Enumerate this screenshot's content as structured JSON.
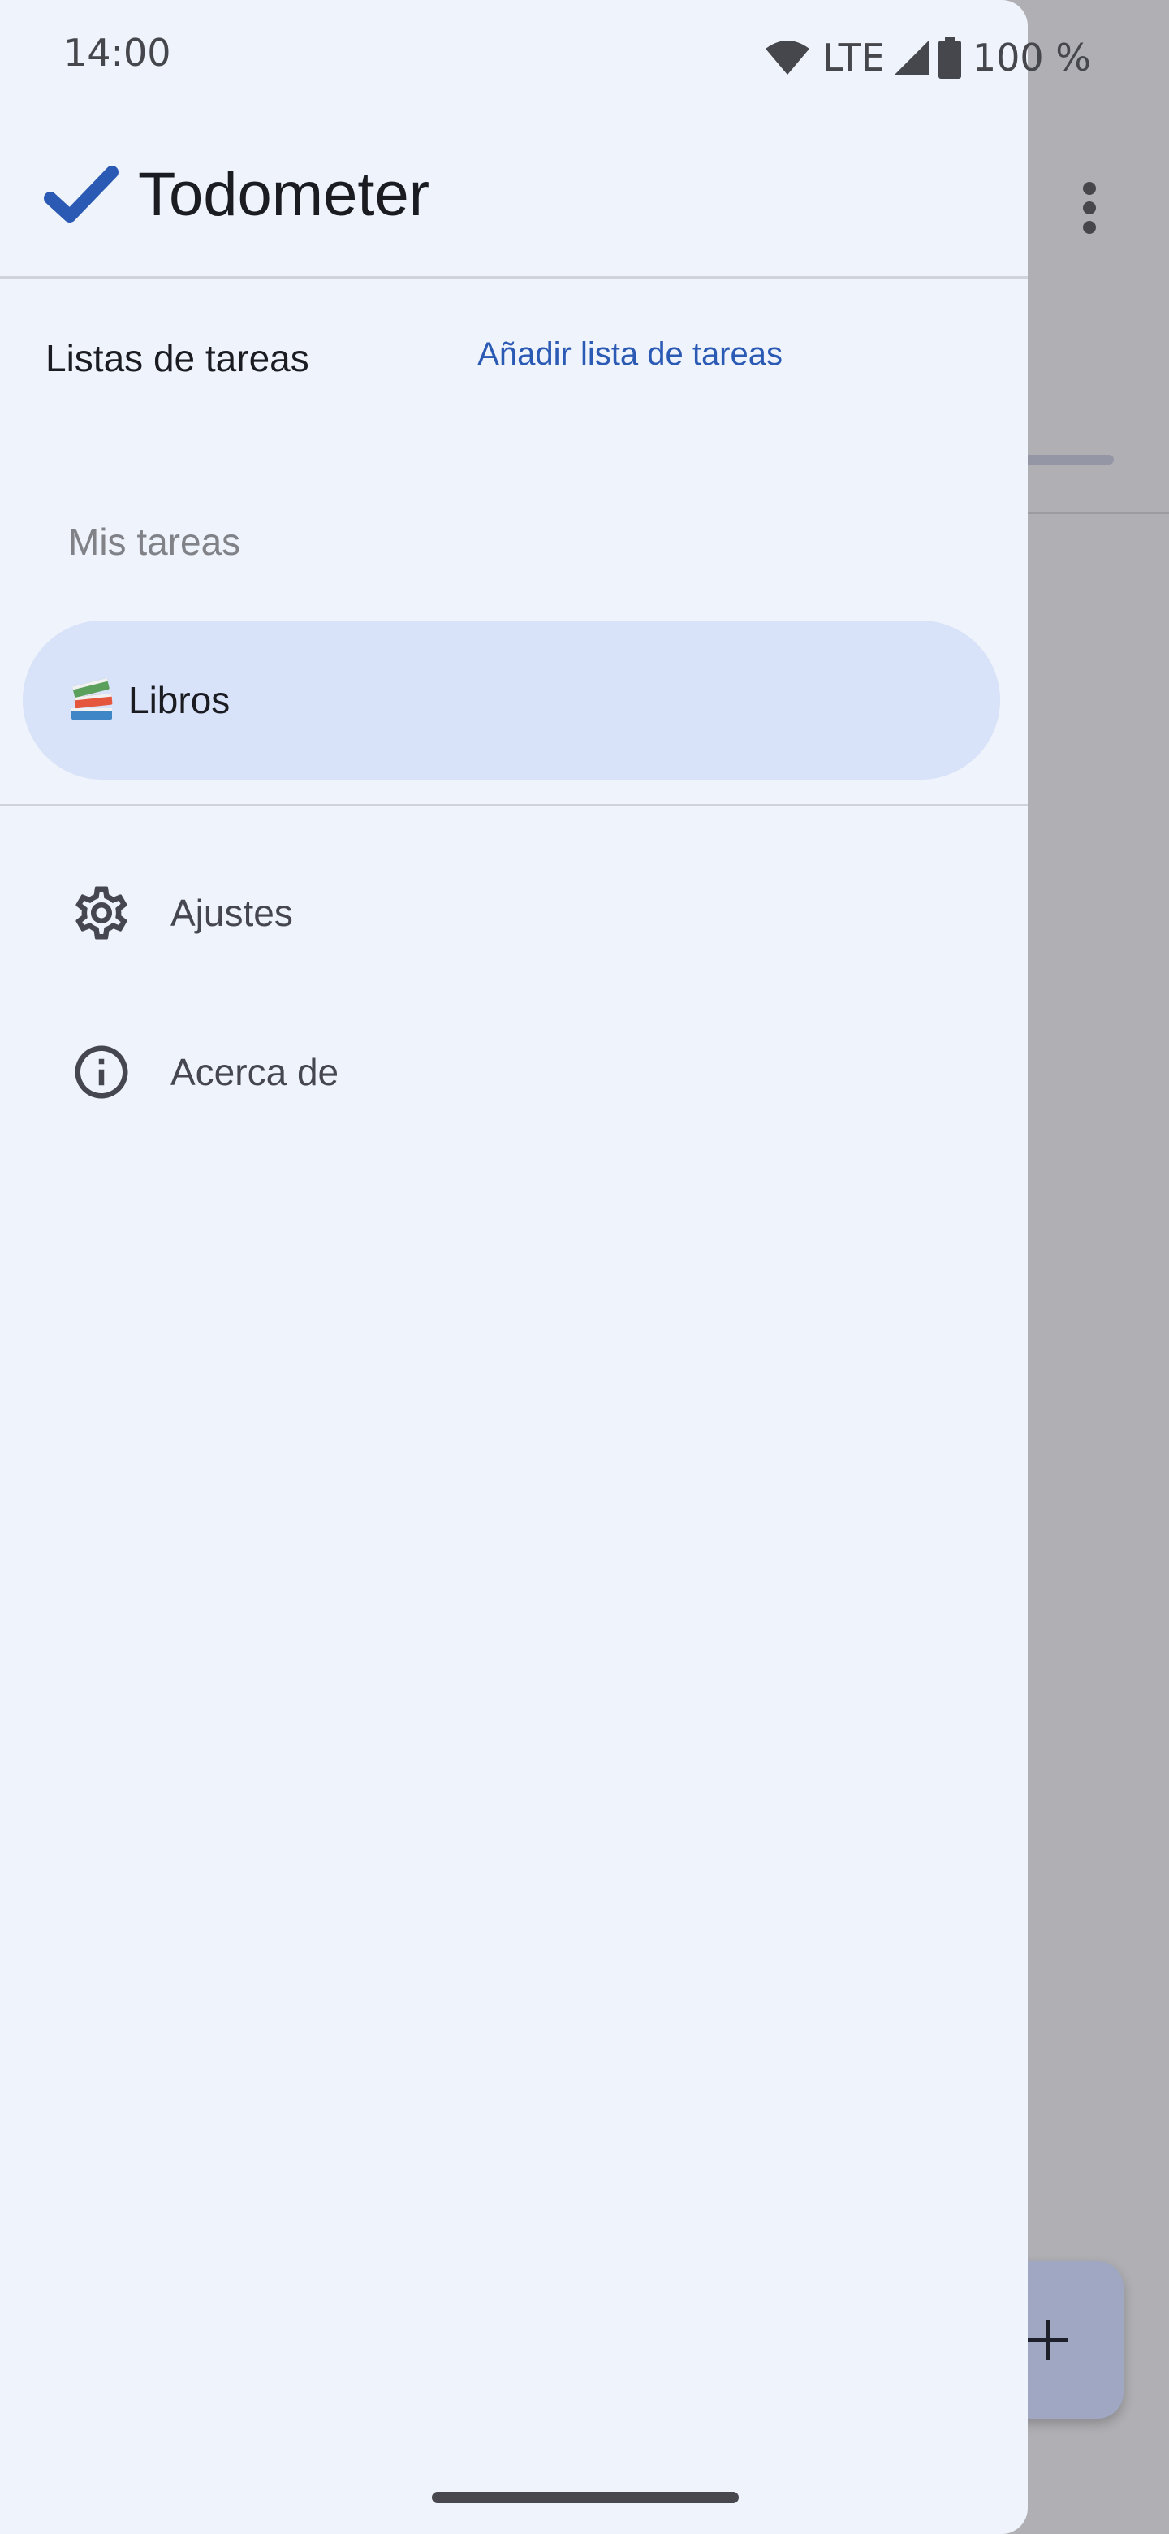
{
  "status_bar": {
    "time": "14:00",
    "network": "LTE",
    "battery": "100 %"
  },
  "drawer": {
    "app_title": "Todometer",
    "section_title": "Listas de tareas",
    "add_list_label": "Añadir lista de tareas",
    "lists": [
      {
        "label": "Mis tareas",
        "selected": false
      },
      {
        "emoji": "📚",
        "label": "Libros",
        "selected": true
      }
    ],
    "menu": [
      {
        "label": "Ajustes",
        "icon": "gear-icon"
      },
      {
        "label": "Acerca de",
        "icon": "info-icon"
      }
    ]
  },
  "colors": {
    "drawer_bg": "#eff3fb",
    "selected_bg": "#d8e2f8",
    "accent": "#2b5ab5",
    "scrim": "#b0afb3"
  }
}
